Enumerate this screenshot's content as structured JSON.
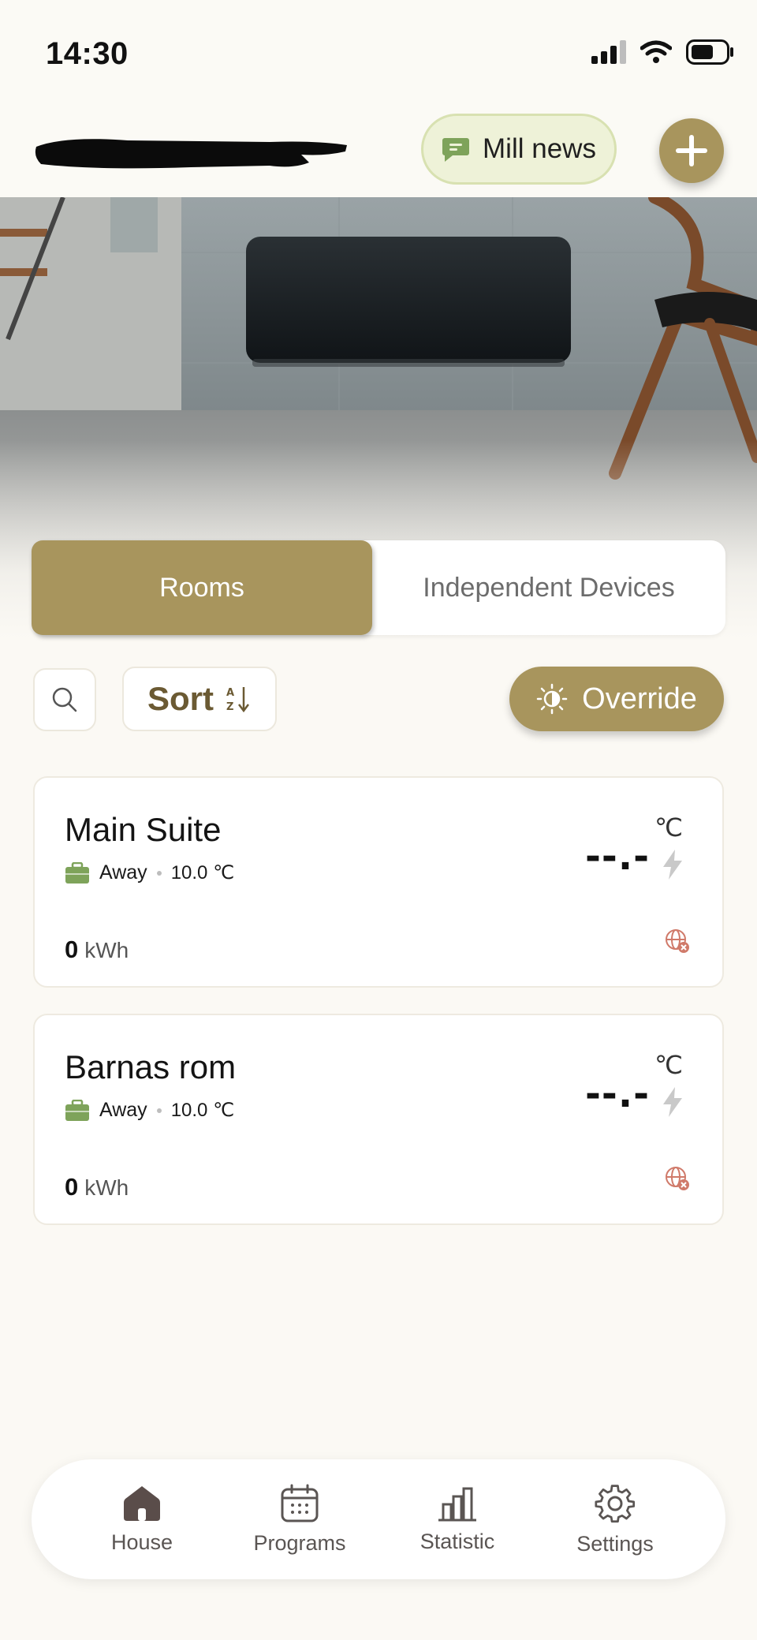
{
  "status_bar": {
    "time": "14:30"
  },
  "header": {
    "news_label": "Mill news"
  },
  "segment": {
    "tabs": [
      {
        "label": "Rooms",
        "active": true
      },
      {
        "label": "Independent Devices",
        "active": false
      }
    ]
  },
  "toolbar": {
    "sort_label": "Sort",
    "override_label": "Override"
  },
  "rooms": [
    {
      "name": "Main Suite",
      "mode": "Away",
      "set_temp": "10.0 ℃",
      "temp_unit": "℃",
      "temp_value": "--.-",
      "energy_value": "0",
      "energy_unit": "kWh"
    },
    {
      "name": "Barnas rom",
      "mode": "Away",
      "set_temp": "10.0 ℃",
      "temp_unit": "℃",
      "temp_value": "--.-",
      "energy_value": "0",
      "energy_unit": "kWh"
    }
  ],
  "nav": {
    "items": [
      {
        "label": "House",
        "icon": "house-icon"
      },
      {
        "label": "Programs",
        "icon": "calendar-icon"
      },
      {
        "label": "Statistic",
        "icon": "bar-chart-icon"
      },
      {
        "label": "Settings",
        "icon": "gear-icon"
      }
    ]
  },
  "colors": {
    "accent": "#a8955d",
    "news_bg": "#eef2d8",
    "away_green": "#7ea35a",
    "offline_red": "#d07a6a"
  }
}
